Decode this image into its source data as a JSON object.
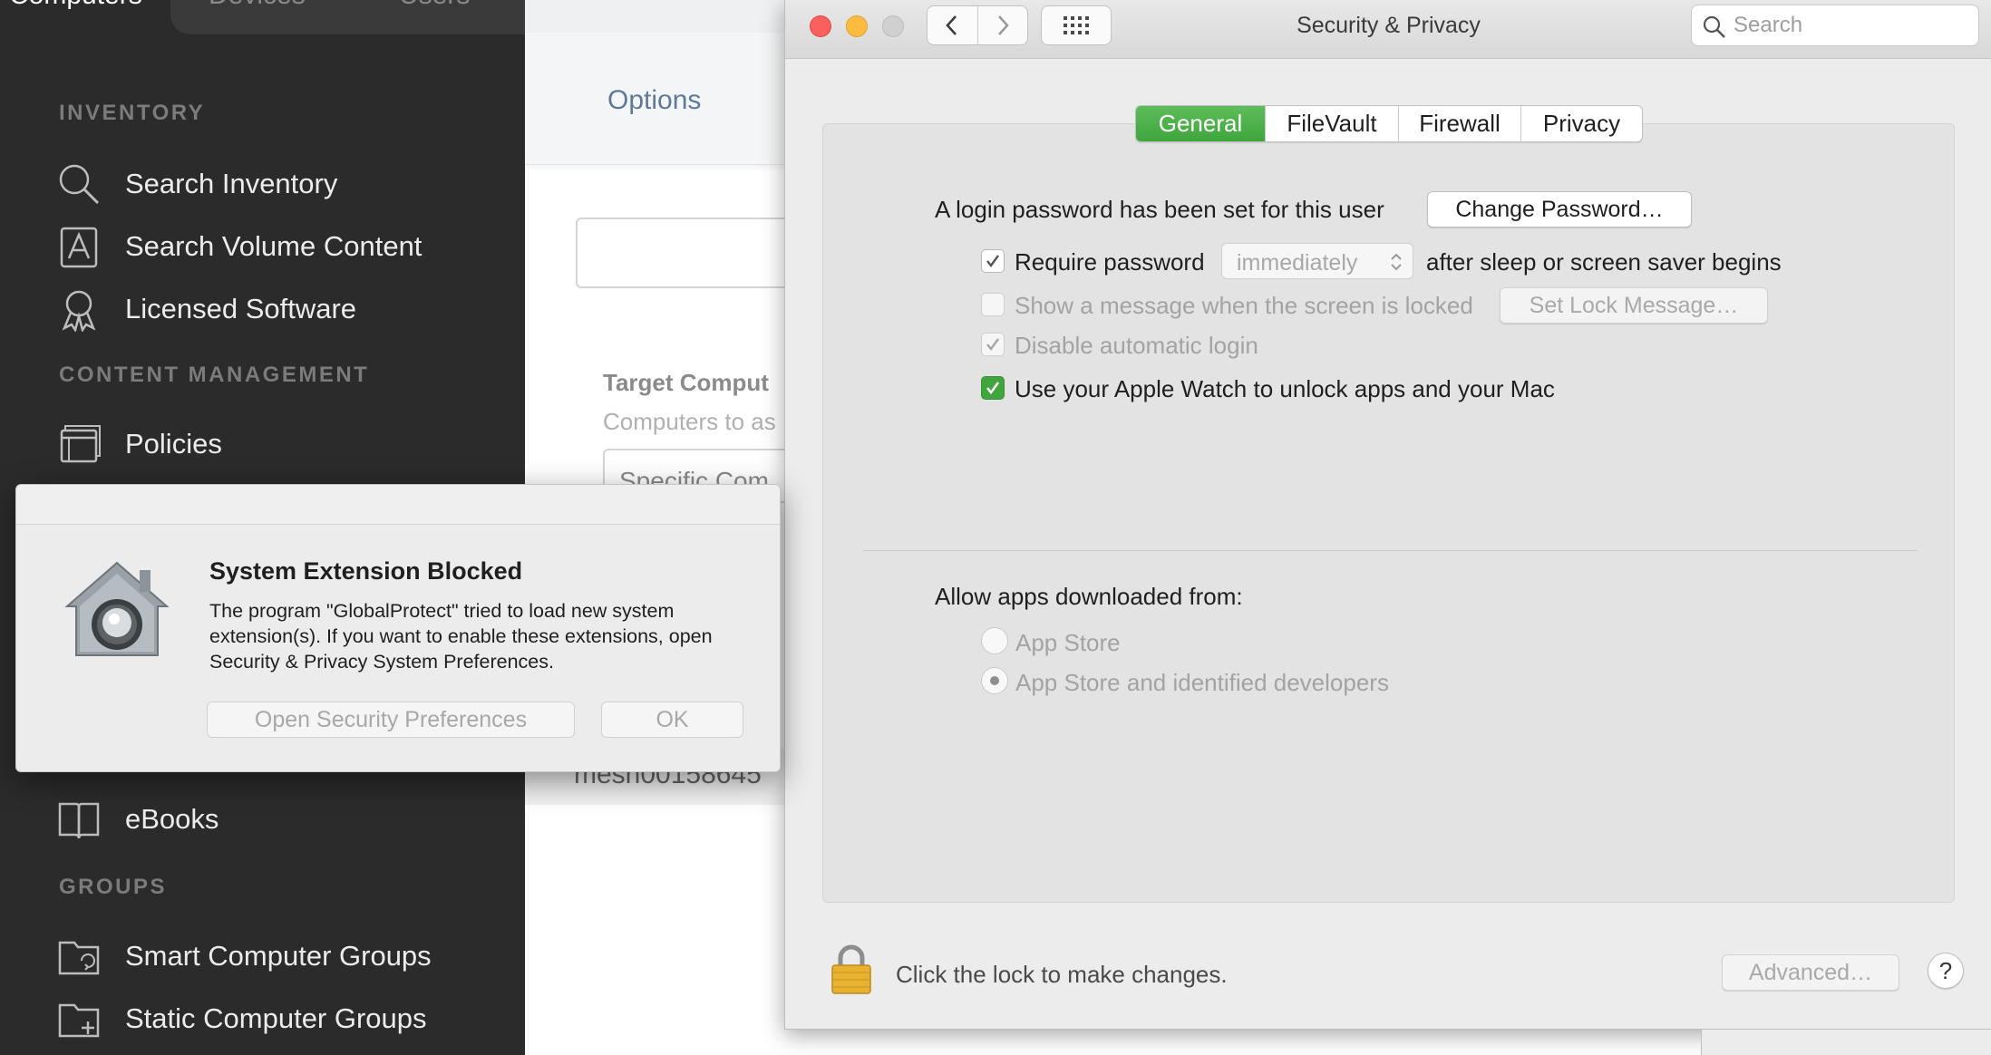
{
  "sidebar": {
    "top_tabs": [
      "Computers",
      "Devices",
      "Users"
    ],
    "sections": [
      {
        "heading": "INVENTORY"
      },
      {
        "heading": "CONTENT MANAGEMENT"
      },
      {
        "heading": "GROUPS"
      }
    ],
    "items": [
      {
        "label": "Search Inventory",
        "icon": "search-icon"
      },
      {
        "label": "Search Volume Content",
        "icon": "volume-content-icon"
      },
      {
        "label": "Licensed Software",
        "icon": "licensed-software-icon"
      },
      {
        "label": "Policies",
        "icon": "policies-icon"
      },
      {
        "label": "eBooks",
        "icon": "ebook-icon"
      },
      {
        "label": "Smart Computer Groups",
        "icon": "smart-group-icon"
      },
      {
        "label": "Static Computer Groups",
        "icon": "static-group-icon"
      }
    ]
  },
  "background_page": {
    "options_tab": "Options",
    "target_heading": "Target Comput",
    "target_sub": "Computers to as",
    "select_value": "Specific Com",
    "row_text": "mesh00158645"
  },
  "security_window": {
    "title": "Security & Privacy",
    "search_placeholder": "Search",
    "tabs": [
      "General",
      "FileVault",
      "Firewall",
      "Privacy"
    ],
    "active_tab": "General",
    "login_password_text": "A login password has been set for this user",
    "change_password_button": "Change Password…",
    "require_password_label": "Require password",
    "require_password_checked": true,
    "require_password_delay": "immediately",
    "after_sleep_text": "after sleep or screen saver begins",
    "show_message_label": "Show a message when the screen is locked",
    "show_message_checked": false,
    "set_lock_message_button": "Set Lock Message…",
    "disable_auto_login_label": "Disable automatic login",
    "disable_auto_login_checked": true,
    "apple_watch_label": "Use your Apple Watch to unlock apps and your Mac",
    "apple_watch_checked": true,
    "allow_apps_heading": "Allow apps downloaded from:",
    "allow_options": [
      "App Store",
      "App Store and identified developers"
    ],
    "allow_selected": "App Store and identified developers",
    "lock_text": "Click the lock to make changes.",
    "advanced_button": "Advanced…",
    "help_button": "?",
    "colors": {
      "accent_green": "#3fa53c",
      "close_red": "#fc605c",
      "minimize_yellow": "#fdbc40"
    }
  },
  "dialog": {
    "title": "System Extension Blocked",
    "body": "The program \"GlobalProtect\" tried to load new system extension(s). If you want to enable these extensions, open Security & Privacy System Preferences.",
    "open_prefs_button": "Open Security Preferences",
    "ok_button": "OK",
    "icon": "security-preferences-icon"
  }
}
